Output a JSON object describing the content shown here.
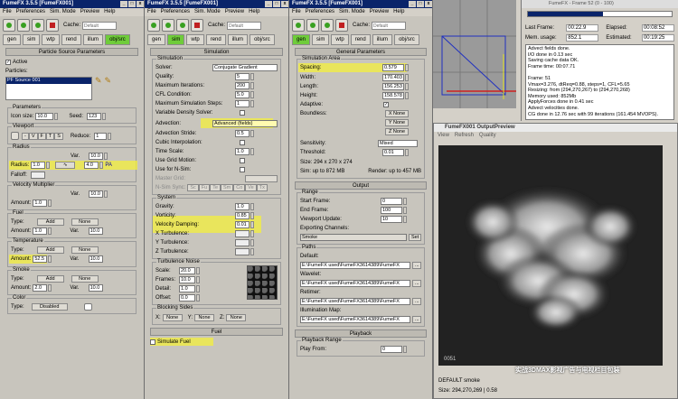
{
  "window_title": "FumeFX 3.5.5 [FumeFX001]",
  "menu": [
    "File",
    "Preferences",
    "Sim. Mode",
    "Preview",
    "Help"
  ],
  "cache_label": "Cache:",
  "cache_value": "Default",
  "tabs": [
    "gen",
    "sim",
    "wtp",
    "rend",
    "illum",
    "obj/src"
  ],
  "p1": {
    "rollout": "Particle Source Parameters",
    "active": "Active",
    "particles": "Particles:",
    "particle_item": "PF Source 001",
    "parameters": "Parameters",
    "icon_size_label": "Icon size:",
    "icon_size": "10.0",
    "seed_label": "Seed:",
    "seed": "123",
    "viewport": "Viewport",
    "vp_buttons": [
      "-",
      "V",
      "F",
      "T",
      "S"
    ],
    "reduce_label": "Reduce:",
    "reduce": "1",
    "radius": "Radius",
    "radius_label": "Radius:",
    "radius_value": "1.0",
    "var_label": "Var.",
    "radius_var": "10.0",
    "radius_var2": "4.0",
    "falloff": "Falloff:",
    "pa": "PA",
    "vel_mult": "Velocity Multiplier",
    "amount_label": "Amount:",
    "vel_amount": "1.0",
    "vel_var": "10.0",
    "fuel": "Fuel",
    "type_label": "Type:",
    "add": "Add",
    "none": "None",
    "fuel_amount": "1.0",
    "fuel_var": "10.0",
    "temperature": "Temperature",
    "temp_amount": "52.5",
    "temp_var": "10.0",
    "smoke": "Smoke",
    "smoke_amount": "2.0",
    "smoke_var": "10.0",
    "color": "Color",
    "disabled": "Disabled"
  },
  "p2": {
    "rollout": "Simulation",
    "simulation": "Simulation",
    "solver_label": "Solver:",
    "solver": "Conjugate Gradient",
    "quality_label": "Quality:",
    "quality": "5",
    "max_iter_label": "Maximum Iterations:",
    "max_iter": "200",
    "cfl_label": "CFL Condition:",
    "cfl": "5.0",
    "max_steps_label": "Maximum Simulation Steps:",
    "max_steps": "1",
    "vds": "Variable Density Solver:",
    "advection_label": "Advection:",
    "advection": "Advanced (fields)",
    "adv_stride_label": "Advection Stride:",
    "adv_stride": "0.5",
    "cubic": "Cubic Interpolation:",
    "time_scale_label": "Time Scale:",
    "time_scale": "1.0",
    "gpu": "Use Grid Motion:",
    "use_nsim": "Use for N-Sim:",
    "master": "Master Grid:",
    "nsim_sync": "N-Sim Sync:",
    "sync_btns": [
      "Sc",
      "Fu",
      "Te",
      "Sm",
      "Co",
      "Ve",
      "Tx"
    ],
    "system": "System",
    "gravity_label": "Gravity:",
    "gravity": "1.0",
    "vorticity_label": "Vorticity:",
    "vorticity": "0.85",
    "vel_damp_label": "Velocity Damping:",
    "vel_damp": "0.01",
    "xt": "X Turbulence:",
    "yt": "Y Turbulence:",
    "zt": "Z Turbulence:",
    "tn": "Turbulence Noise",
    "scale_label": "Scale:",
    "scale": "20.0",
    "frames_label": "Frames:",
    "frames": "10.0",
    "detail_label": "Detail:",
    "detail": "1.0",
    "offset_label": "Offset:",
    "offset": "0.0",
    "blocking": "Blocking Sides",
    "bx": "X:",
    "by": "Y:",
    "bz": "Z:",
    "none": "None",
    "fuel_roll": "Fuel",
    "simulate_fuel": "Simulate Fuel"
  },
  "p3": {
    "rollout": "General Parameters",
    "sim_area": "Simulation Area",
    "spacing_label": "Spacing:",
    "spacing": "0.579",
    "width_label": "Width:",
    "width": "170.403",
    "length_label": "Length:",
    "length": "156.253",
    "height_label": "Height:",
    "height": "158.578",
    "adaptive": "Adaptive:",
    "boundless": "Boundless:",
    "xn": "X None",
    "yn": "Y None",
    "zn": "Z None",
    "sens_label": "Sensitivity:",
    "sens": "Mixed",
    "thr_label": "Threshold:",
    "thr": "0.01",
    "size": "Size: 294 x 270 x 274",
    "sim_up": "Sim: up to 872 MB",
    "rend_up": "Render: up to 457 MB",
    "output": "Output",
    "range": "Range",
    "start_label": "Start Frame:",
    "start": "0",
    "end_label": "End Frame:",
    "end": "100",
    "vpu_label": "Viewport Update:",
    "vpu": "10",
    "exp_label": "Exporting Channels:",
    "smoke": "Smoke",
    "set": "Set",
    "paths": "Paths",
    "default_label": "Default:",
    "default_path": "E:\\FumeFX used\\FumeFX3614389\\FumeFX",
    "wavelet_label": "Wavelet:",
    "wavelet_path": "E:\\FumeFX used\\FumeFX3614389\\FumeFX",
    "retimer_label": "Retimer:",
    "retimer_path": "E:\\FumeFX used\\FumeFX3614389\\FumeFX",
    "illum_label": "Illumination Map:",
    "illum_path": "E:\\FumeFX used\\FumeFX3614389\\FumeFX",
    "playback": "Playback",
    "pb_range": "Playback Range",
    "play_from_label": "Play From:",
    "play_from": "0",
    "dots": "..."
  },
  "stats": {
    "title": "FumeFX - Frame 52 (0 - 100)",
    "progress": 0.52,
    "last_frame_label": "Last Frame:",
    "last_frame": "00:22.9",
    "elapsed_label": "Elapsed:",
    "elapsed": "00:08:52",
    "mem_label": "Mem. usage:",
    "mem": "852.1",
    "est_label": "Estimated:",
    "est": "00:19:25",
    "log": [
      "Advect fields done.",
      "I/O done in 0.13 sec",
      "Saving cache data OK.",
      "Frame time: 00:07.71",
      "",
      "Frame: 51",
      "Vmax=3.276, dtReq=0.88, steps=1, CFL=5.65",
      "Resizing: from (294,270,267) to (294,270,268)",
      "Memory used: 852Mb",
      "ApplyForces done in 0.41 sec",
      "Advect velocities done.",
      "CG done in 12.76 sec with 99 iterations (161.454 MVOPS)."
    ]
  },
  "preview": {
    "title": "FumeFX001 OutputPreview",
    "menu": [
      "View",
      "Refresh",
      "Quality"
    ],
    "frame": "0051",
    "watermark": "实战3DMAX影视广告与电视栏目包装",
    "status1": "DEFAULT smoke",
    "status2": "Size: 294,270,269 | 0.58"
  }
}
